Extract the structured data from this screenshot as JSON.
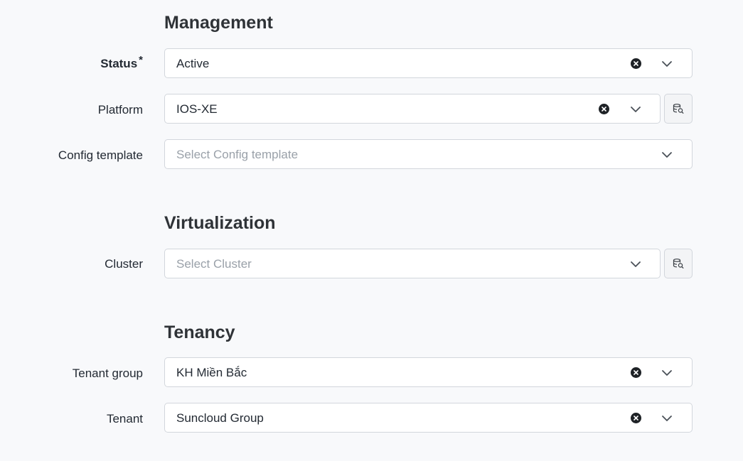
{
  "sections": {
    "management": {
      "title": "Management",
      "status": {
        "label": "Status",
        "required_mark": "*",
        "value": "Active"
      },
      "platform": {
        "label": "Platform",
        "value": "IOS-XE"
      },
      "config_template": {
        "label": "Config template",
        "placeholder": "Select Config template"
      }
    },
    "virtualization": {
      "title": "Virtualization",
      "cluster": {
        "label": "Cluster",
        "placeholder": "Select Cluster"
      }
    },
    "tenancy": {
      "title": "Tenancy",
      "tenant_group": {
        "label": "Tenant group",
        "value": "KH Miền Bắc"
      },
      "tenant": {
        "label": "Tenant",
        "value": "Suncloud Group"
      }
    }
  },
  "icons": {
    "clear": "clear-icon",
    "dropdown": "chevron-down-icon",
    "lookup": "database-search-icon"
  },
  "colors": {
    "background": "#f8f9fb",
    "text": "#232a33",
    "placeholder": "#9aa1a9",
    "border": "#d2d6dc"
  }
}
